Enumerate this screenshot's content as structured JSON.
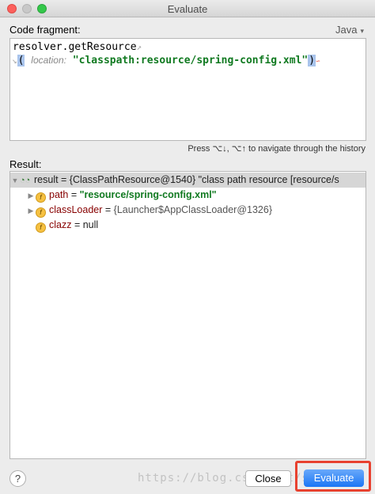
{
  "window": {
    "title": "Evaluate"
  },
  "code_fragment": {
    "label": "Code fragment:",
    "language": "Java",
    "line1": "resolver.getResource",
    "paren_open": "(",
    "param_hint": "location:",
    "string_value": "\"classpath:resource/spring-config.xml\"",
    "paren_close": ")"
  },
  "history_hint": "Press ⌥↓, ⌥↑ to navigate through the history",
  "result": {
    "label": "Result:",
    "root": {
      "text": "result = {ClassPathResource@1540} \"class path resource [resource/s"
    },
    "children": [
      {
        "name": "path",
        "eq": " = ",
        "value": "\"resource/spring-config.xml\"",
        "expandable": true
      },
      {
        "name": "classLoader",
        "eq": " = ",
        "value": "{Launcher$AppClassLoader@1326}",
        "expandable": true
      },
      {
        "name": "clazz",
        "eq": " = ",
        "value": "null",
        "expandable": false
      }
    ]
  },
  "buttons": {
    "help": "?",
    "close": "Close",
    "evaluate": "Evaluate"
  },
  "watermark": "https://blog.csdn.net/ss",
  "colors": {
    "accent": "#1b76f5",
    "highlight": "#e8412f",
    "string": "#117a21"
  }
}
